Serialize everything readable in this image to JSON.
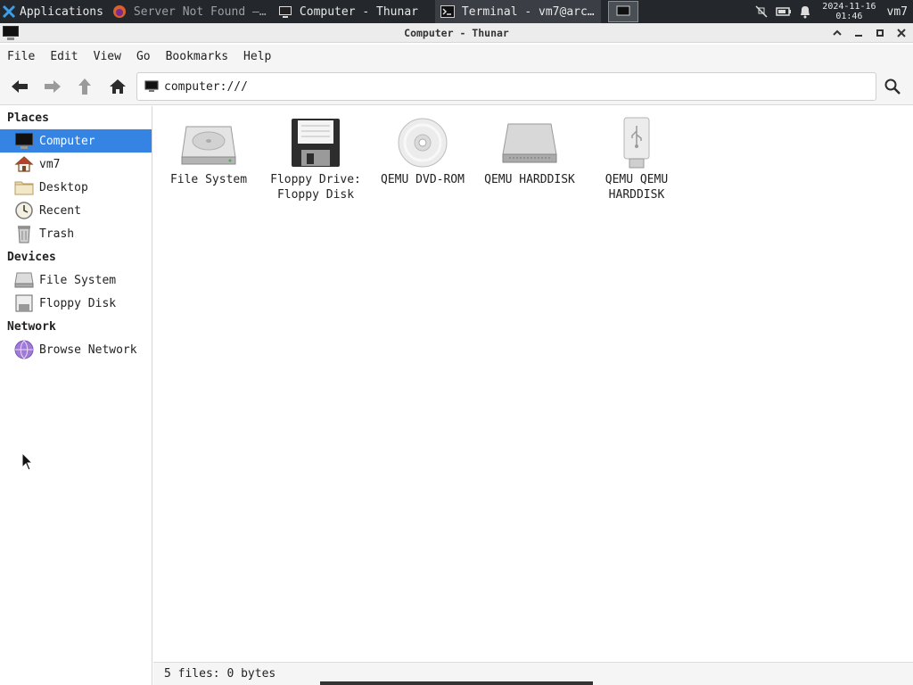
{
  "panel": {
    "apps_label": "Applications",
    "tasks": [
      {
        "label": "Server Not Found —…",
        "icon": "firefox-icon"
      },
      {
        "label": "Computer - Thunar",
        "icon": "computer-icon"
      },
      {
        "label": "Terminal - vm7@arc…",
        "icon": "terminal-icon"
      }
    ],
    "clock_date": "2024-11-16",
    "clock_time": "01:46",
    "user": "vm7"
  },
  "window": {
    "title": "Computer - Thunar",
    "buttons": {
      "restore": "^",
      "minimize": "_",
      "maximize": "□",
      "close": "✕"
    }
  },
  "menubar": [
    "File",
    "Edit",
    "View",
    "Go",
    "Bookmarks",
    "Help"
  ],
  "toolbar": {
    "location": "computer:///"
  },
  "sidebar": {
    "sections": [
      {
        "title": "Places",
        "items": [
          {
            "label": "Computer",
            "icon": "computer-icon",
            "selected": true
          },
          {
            "label": "vm7",
            "icon": "home-icon"
          },
          {
            "label": "Desktop",
            "icon": "folder-icon"
          },
          {
            "label": "Recent",
            "icon": "clock-icon"
          },
          {
            "label": "Trash",
            "icon": "trash-icon"
          }
        ]
      },
      {
        "title": "Devices",
        "items": [
          {
            "label": "File System",
            "icon": "harddisk-icon"
          },
          {
            "label": "Floppy Disk",
            "icon": "floppy-icon"
          }
        ]
      },
      {
        "title": "Network",
        "items": [
          {
            "label": "Browse Network",
            "icon": "network-icon"
          }
        ]
      }
    ]
  },
  "files": [
    {
      "label": "File System",
      "icon": "harddisk-icon"
    },
    {
      "label": "Floppy Drive:\nFloppy Disk",
      "icon": "floppy-icon"
    },
    {
      "label": "QEMU DVD-ROM",
      "icon": "optical-disc-icon"
    },
    {
      "label": "QEMU HARDDISK",
      "icon": "harddisk-icon"
    },
    {
      "label": "QEMU QEMU\nHARDDISK",
      "icon": "usb-drive-icon"
    }
  ],
  "statusbar": {
    "text": "5 files: 0 bytes"
  },
  "colors": {
    "selection": "#3584e4",
    "panel": "#24272b"
  }
}
